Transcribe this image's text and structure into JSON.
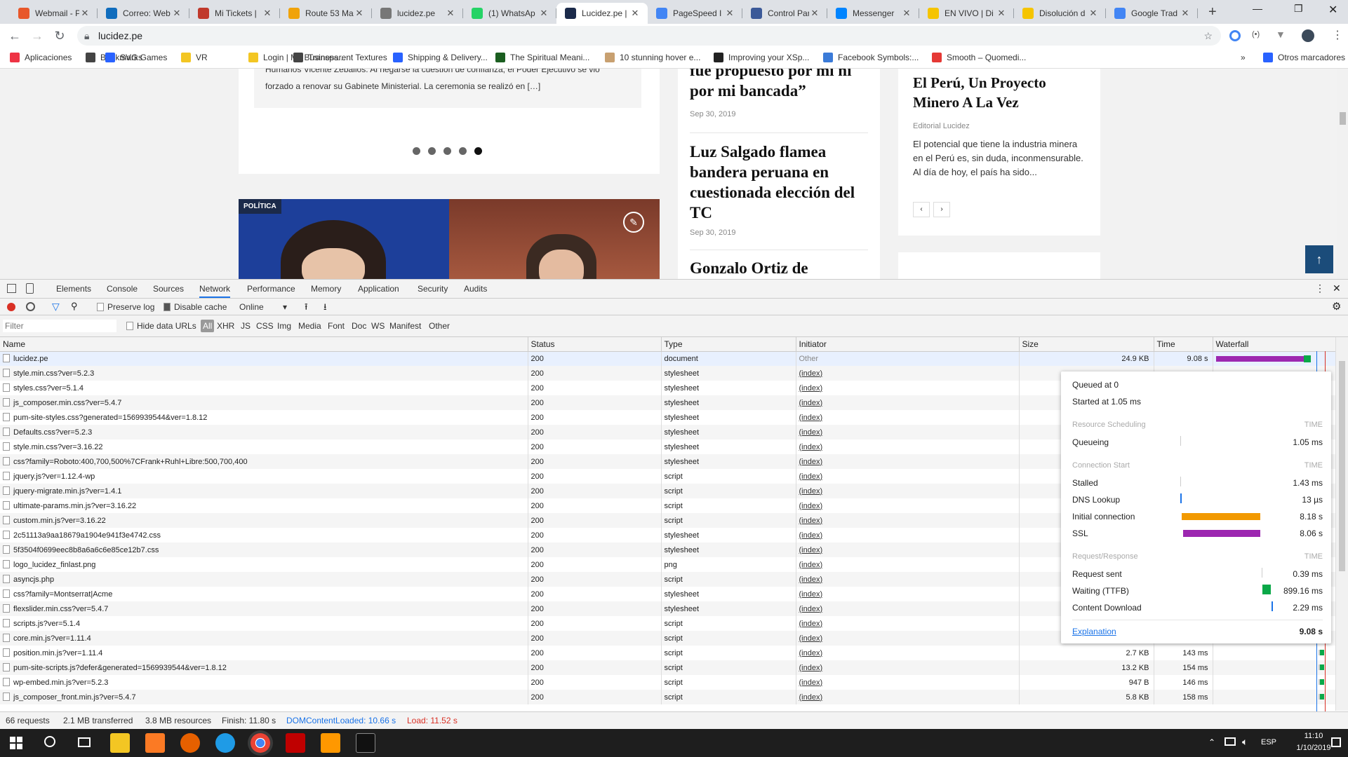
{
  "browser": {
    "tabs": [
      {
        "title": "Webmail - P",
        "color": "#e8572a"
      },
      {
        "title": "Correo: Web",
        "color": "#0f6cbd"
      },
      {
        "title": "Mi Tickets |",
        "color": "#c0392b"
      },
      {
        "title": "Route 53 Ma",
        "color": "#f0a30a"
      },
      {
        "title": "lucidez.pe",
        "color": "#777777"
      },
      {
        "title": "(1) WhatsAp",
        "color": "#25d366"
      },
      {
        "title": "Lucidez.pe |",
        "color": "#1b2a4a"
      },
      {
        "title": "PageSpeed I",
        "color": "#4285f4"
      },
      {
        "title": "Control Pan",
        "color": "#3b5998"
      },
      {
        "title": "Messenger",
        "color": "#0084ff"
      },
      {
        "title": "EN VIVO | Di",
        "color": "#f5c400"
      },
      {
        "title": "Disolución d",
        "color": "#f5c400"
      },
      {
        "title": "Google Trad",
        "color": "#4285f4"
      }
    ],
    "url": "lucidez.pe",
    "bookmarks": [
      "Aplicaciones",
      "Bookmarks",
      "SVG Games",
      "VR",
      "Login | My Business...",
      "Transparent Textures",
      "Shipping & Delivery...",
      "The Spiritual Meani...",
      "10 stunning hover e...",
      "Improving your XSp...",
      "Facebook Symbols:...",
      "Smooth – Quomedi...",
      "Otros marcadores"
    ]
  },
  "page": {
    "excerpt_partial": "Humanos Vicente Zeballos. Al negarse la cuestión de confianza, el Poder Ejecutivo se vio",
    "excerpt": "forzado a renovar su Gabinete Ministerial. La ceremonia se realizó en […]",
    "category": "POLÍTICA",
    "headline1_partial": "fue propuesto por mí ni por mi bancada”",
    "date1": "Sep 30, 2019",
    "headline2": "Luz Salgado flamea bandera peruana en cuestionada elección del TC",
    "date2": "Sep 30, 2019",
    "headline3_partial": "Gonzalo Ortiz de",
    "editorial_title": "El Perú, Un Proyecto Minero A La Vez",
    "editorial_author": "Editorial Lucidez",
    "editorial_text": "El potencial que tiene la industria minera en el Perú es, sin duda, inconmensurable. Al día de hoy, el país ha sido..."
  },
  "devtools": {
    "panels": [
      "Elements",
      "Console",
      "Sources",
      "Network",
      "Performance",
      "Memory",
      "Application",
      "Security",
      "Audits"
    ],
    "active_panel": "Network",
    "toolbar": {
      "preserve_log": "Preserve log",
      "disable_cache": "Disable cache",
      "throttling": "Online"
    },
    "filter_placeholder": "Filter",
    "hide_data_urls": "Hide data URLs",
    "filter_types": [
      "All",
      "XHR",
      "JS",
      "CSS",
      "Img",
      "Media",
      "Font",
      "Doc",
      "WS",
      "Manifest",
      "Other"
    ],
    "columns": [
      "Name",
      "Status",
      "Type",
      "Initiator",
      "Size",
      "Time",
      "Waterfall"
    ],
    "rows": [
      {
        "name": "lucidez.pe",
        "status": "200",
        "type": "document",
        "initiator": "Other",
        "size": "24.9 KB",
        "time": "9.08 s"
      },
      {
        "name": "style.min.css?ver=5.2.3",
        "status": "200",
        "type": "stylesheet",
        "initiator": "(index)",
        "size": "",
        "time": ""
      },
      {
        "name": "styles.css?ver=5.1.4",
        "status": "200",
        "type": "stylesheet",
        "initiator": "(index)",
        "size": "",
        "time": ""
      },
      {
        "name": "js_composer.min.css?ver=5.4.7",
        "status": "200",
        "type": "stylesheet",
        "initiator": "(index)",
        "size": "",
        "time": ""
      },
      {
        "name": "pum-site-styles.css?generated=1569939544&ver=1.8.12",
        "status": "200",
        "type": "stylesheet",
        "initiator": "(index)",
        "size": "",
        "time": ""
      },
      {
        "name": "Defaults.css?ver=5.2.3",
        "status": "200",
        "type": "stylesheet",
        "initiator": "(index)",
        "size": "",
        "time": ""
      },
      {
        "name": "style.min.css?ver=3.16.22",
        "status": "200",
        "type": "stylesheet",
        "initiator": "(index)",
        "size": "",
        "time": ""
      },
      {
        "name": "css?family=Roboto:400,700,500%7CFrank+Ruhl+Libre:500,700,400",
        "status": "200",
        "type": "stylesheet",
        "initiator": "(index)",
        "size": "",
        "time": ""
      },
      {
        "name": "jquery.js?ver=1.12.4-wp",
        "status": "200",
        "type": "script",
        "initiator": "(index)",
        "size": "",
        "time": ""
      },
      {
        "name": "jquery-migrate.min.js?ver=1.4.1",
        "status": "200",
        "type": "script",
        "initiator": "(index)",
        "size": "",
        "time": ""
      },
      {
        "name": "ultimate-params.min.js?ver=3.16.22",
        "status": "200",
        "type": "script",
        "initiator": "(index)",
        "size": "",
        "time": ""
      },
      {
        "name": "custom.min.js?ver=3.16.22",
        "status": "200",
        "type": "script",
        "initiator": "(index)",
        "size": "",
        "time": ""
      },
      {
        "name": "2c51113a9aa18679a1904e941f3e4742.css",
        "status": "200",
        "type": "stylesheet",
        "initiator": "(index)",
        "size": "",
        "time": ""
      },
      {
        "name": "5f3504f0699eec8b8a6a6c6e85ce12b7.css",
        "status": "200",
        "type": "stylesheet",
        "initiator": "(index)",
        "size": "",
        "time": ""
      },
      {
        "name": "logo_lucidez_finlast.png",
        "status": "200",
        "type": "png",
        "initiator": "(index)",
        "size": "",
        "time": ""
      },
      {
        "name": "asyncjs.php",
        "status": "200",
        "type": "script",
        "initiator": "(index)",
        "size": "",
        "time": ""
      },
      {
        "name": "css?family=Montserrat|Acme",
        "status": "200",
        "type": "stylesheet",
        "initiator": "(index)",
        "size": "",
        "time": ""
      },
      {
        "name": "flexslider.min.css?ver=5.4.7",
        "status": "200",
        "type": "stylesheet",
        "initiator": "(index)",
        "size": "",
        "time": ""
      },
      {
        "name": "scripts.js?ver=5.1.4",
        "status": "200",
        "type": "script",
        "initiator": "(index)",
        "size": "",
        "time": ""
      },
      {
        "name": "core.min.js?ver=1.11.4",
        "status": "200",
        "type": "script",
        "initiator": "(index)",
        "size": "",
        "time": ""
      },
      {
        "name": "position.min.js?ver=1.11.4",
        "status": "200",
        "type": "script",
        "initiator": "(index)",
        "size": "2.7 KB",
        "time": "143 ms"
      },
      {
        "name": "pum-site-scripts.js?defer&generated=1569939544&ver=1.8.12",
        "status": "200",
        "type": "script",
        "initiator": "(index)",
        "size": "13.2 KB",
        "time": "154 ms"
      },
      {
        "name": "wp-embed.min.js?ver=5.2.3",
        "status": "200",
        "type": "script",
        "initiator": "(index)",
        "size": "947 B",
        "time": "146 ms"
      },
      {
        "name": "js_composer_front.min.js?ver=5.4.7",
        "status": "200",
        "type": "script",
        "initiator": "(index)",
        "size": "5.8 KB",
        "time": "158 ms"
      }
    ],
    "timing": {
      "queued": "Queued at 0",
      "started": "Started at 1.05 ms",
      "sections": [
        {
          "title": "Resource Scheduling",
          "rows": [
            {
              "label": "Queueing",
              "value": "1.05 ms"
            }
          ]
        },
        {
          "title": "Connection Start",
          "rows": [
            {
              "label": "Stalled",
              "value": "1.43 ms"
            },
            {
              "label": "DNS Lookup",
              "value": "13 µs"
            },
            {
              "label": "Initial connection",
              "value": "8.18 s"
            },
            {
              "label": "SSL",
              "value": "8.06 s"
            }
          ]
        },
        {
          "title": "Request/Response",
          "rows": [
            {
              "label": "Request sent",
              "value": "0.39 ms"
            },
            {
              "label": "Waiting (TTFB)",
              "value": "899.16 ms"
            },
            {
              "label": "Content Download",
              "value": "2.29 ms"
            }
          ]
        }
      ],
      "time_header": "TIME",
      "explanation": "Explanation",
      "total": "9.08 s"
    },
    "status": {
      "requests": "66 requests",
      "transferred": "2.1 MB transferred",
      "resources": "3.8 MB resources",
      "finish": "Finish: 11.80 s",
      "domcontentloaded": "DOMContentLoaded: 10.66 s",
      "load": "Load: 11.52 s"
    }
  },
  "taskbar": {
    "lang": "ESP",
    "time": "11:10",
    "date": "1/10/2019"
  }
}
